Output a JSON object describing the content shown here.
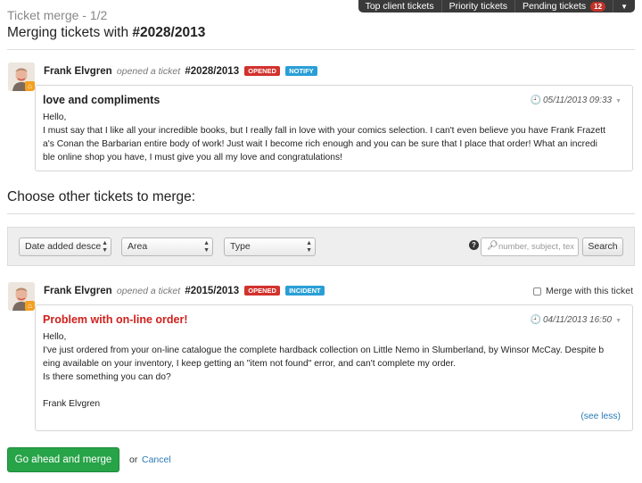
{
  "topnav": {
    "items": [
      {
        "label": "Top client tickets"
      },
      {
        "label": "Priority tickets"
      },
      {
        "label": "Pending tickets",
        "badge": "12"
      }
    ]
  },
  "header": {
    "subtitle": "Ticket merge - 1/2",
    "title_prefix": "Merging tickets with ",
    "title_number": "#2028/2013"
  },
  "main_ticket": {
    "author": "Frank Elvgren",
    "verb": "opened a ticket",
    "number": "#2028/2013",
    "status": "OPENED",
    "type": "NOTIFY",
    "subject": "love and compliments",
    "date": "05/11/2013 09:33",
    "body": "Hello,\nI must say that I like all your incredible books, but I really fall in love with your comics selection. I can't even believe you have Frank Frazett\na's Conan the Barbarian entire body of work! Just wait I become rich enough and you can be sure that I place that order! What an incredi\nble online shop you have, I must give you all my love and congratulations!"
  },
  "section": {
    "title": "Choose other tickets to merge:"
  },
  "filters": {
    "sort": "Date added desce",
    "area": "Area",
    "type": "Type",
    "search_placeholder": "number, subject, tex",
    "search_button": "Search"
  },
  "candidate_ticket": {
    "author": "Frank Elvgren",
    "verb": "opened a ticket",
    "number": "#2015/2013",
    "status": "OPENED",
    "type": "INCIDENT",
    "merge_label": "Merge with this ticket",
    "subject": "Problem with on-line order!",
    "date": "04/11/2013 16:50",
    "body": "Hello,\nI've just ordered from your on-line catalogue the complete hardback collection on Little Nemo in Slumberland, by Winsor McCay. Despite b\neing available on your inventory, I keep getting an \"item not found\" error, and can't complete my order.\nIs there something you can do?\n\nFrank Elvgren",
    "see_less": "(see less)"
  },
  "footer": {
    "go_button": "Go ahead and merge",
    "or": "or",
    "cancel": "Cancel"
  },
  "colors": {
    "opened_tag": "#d2322d",
    "info_tag": "#2a9fd6",
    "primary_button": "#27a348",
    "link": "#2a7ab5",
    "subject_alert": "#d0201c"
  },
  "icons": [
    "home-icon",
    "clock-icon",
    "question-icon",
    "search-icon",
    "caret-down-icon"
  ]
}
